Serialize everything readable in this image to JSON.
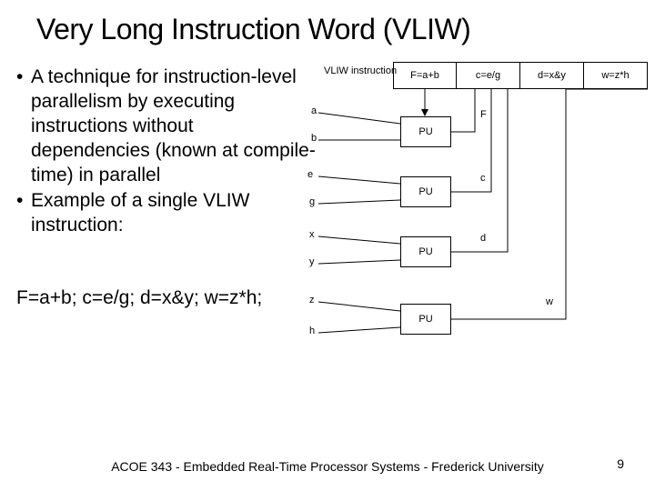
{
  "title": "Very Long Instruction Word (VLIW)",
  "bullets": [
    "A technique for instruction-level parallelism by executing instructions without dependencies (known at compile-time) in parallel",
    "Example of a single VLIW instruction:"
  ],
  "code_line": "F=a+b; c=e/g; d=x&y; w=z*h;",
  "footer": "ACOE 343 - Embedded Real-Time Processor Systems - Frederick University",
  "page_num": "9",
  "diagram": {
    "vliw_label": "VLIW instruction",
    "instr": [
      "F=a+b",
      "c=e/g",
      "d=x&y",
      "w=z*h"
    ],
    "inputs": [
      "a",
      "b",
      "e",
      "g",
      "x",
      "y",
      "z",
      "h"
    ],
    "outputs": [
      "F",
      "c",
      "d",
      "w"
    ],
    "pu_label": "PU"
  }
}
